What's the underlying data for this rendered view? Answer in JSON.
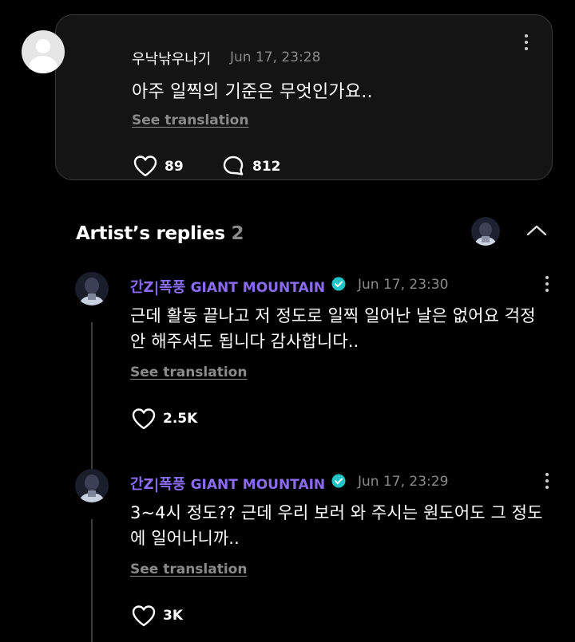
{
  "comment": {
    "username": "우낙낚우나기",
    "timestamp": "Jun 17, 23:28",
    "text": "아주 일찍의 기준은 무엇인가요..",
    "see_translation": "See translation",
    "like_count": "89",
    "reply_count": "812",
    "icons": [
      "user-avatar-placeholder",
      "more-options-icon",
      "heart-icon",
      "comment-bubble-icon"
    ]
  },
  "artist_replies": {
    "title": "Artist’s replies",
    "count": "2",
    "icons": [
      "artist-avatar",
      "chevron-up-icon"
    ]
  },
  "replies": [
    {
      "author": "간Z|폭풍 GIANT MOUNTAIN",
      "author_prefix": "간Z|폭풍",
      "author_suffix": "GIANT MOUNTAIN",
      "timestamp": "Jun 17, 23:30",
      "text": "근데 활동 끝나고 저 정도로 일찍 일어난 날은 없어요 걱정 안 해주셔도 됩니다 감사합니다..",
      "see_translation": "See translation",
      "like_count": "2.5K"
    },
    {
      "author": "간Z|폭풍 GIANT MOUNTAIN",
      "author_prefix": "간Z|폭풍",
      "author_suffix": "GIANT MOUNTAIN",
      "timestamp": "Jun 17, 23:29",
      "text": "3~4시 정도?? 근데 우리 보러 와 주시는 원도어도 그 정도에 일어나니까..",
      "see_translation": "See translation",
      "like_count": "3K"
    }
  ],
  "colors": {
    "background": "#000000",
    "card": "#141414",
    "accent_name": "#8b6cf0",
    "verified_badge": "#23c4c8",
    "muted_text": "#8a8a8a"
  }
}
